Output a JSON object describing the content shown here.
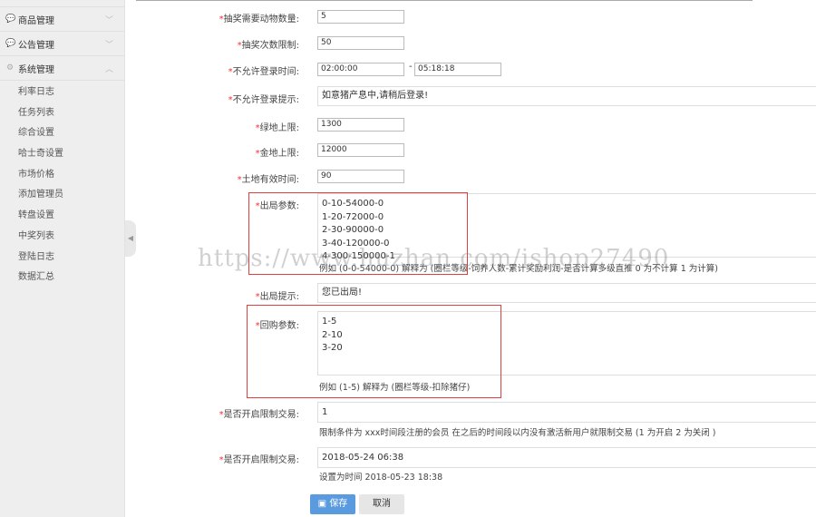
{
  "sidebar": {
    "groups": [
      {
        "label": "商品管理",
        "icon": "chat-icon"
      },
      {
        "label": "公告管理",
        "icon": "chat-icon"
      },
      {
        "label": "系统管理",
        "icon": "gear-icon"
      }
    ],
    "items": [
      "利率日志",
      "任务列表",
      "综合设置",
      "哈士奇设置",
      "市场价格",
      "添加管理员",
      "转盘设置",
      "中奖列表",
      "登陆日志",
      "数据汇总"
    ]
  },
  "form": {
    "lottery_count_label": "抽奖需要动物数量:",
    "lottery_count": "5",
    "lottery_limit_label": "抽奖次数限制:",
    "lottery_limit": "50",
    "no_login_time_label": "不允许登录时间:",
    "no_login_start": "02:00:00",
    "no_login_sep": "-",
    "no_login_end": "05:18:18",
    "no_login_tip_label": "不允许登录提示:",
    "no_login_tip": "如意猪产息中,请稍后登录!",
    "green_limit_label": "绿地上限:",
    "green_limit": "1300",
    "gold_limit_label": "金地上限:",
    "gold_limit": "12000",
    "land_valid_label": "土地有效时间:",
    "land_valid": "90",
    "out_params_label": "出局参数:",
    "out_params": "0-10-54000-0\n1-20-72000-0\n2-30-90000-0\n3-40-120000-0\n4-300-150000-1",
    "out_params_hint": "例如 (0-0-54000-0) 解释为 (圈栏等级-饲养人数-累计奖励利润-是否计算多级直推 0 为不计算 1 为计算)",
    "out_tip_label": "出局提示:",
    "out_tip": "您已出局!",
    "buyback_label": "回购参数:",
    "buyback": "1-5\n2-10\n3-20",
    "buyback_hint": "例如 (1-5) 解释为 (圈栏等级-扣除猪仔)",
    "restrict_label": "是否开启限制交易:",
    "restrict": "1",
    "restrict_hint": "限制条件为 xxx时间段注册的会员 在之后的时间段以内没有激活新用户就限制交易 (1 为开启 2 为关闭 )",
    "restrict_time_label": "是否开启限制交易:",
    "restrict_time": "2018-05-24 06:38",
    "restrict_time_hint": "设置为时间 2018-05-23 18:38",
    "save": "保存",
    "cancel": "取消"
  },
  "watermark": "https://www.huzhan.com/ishop27490"
}
